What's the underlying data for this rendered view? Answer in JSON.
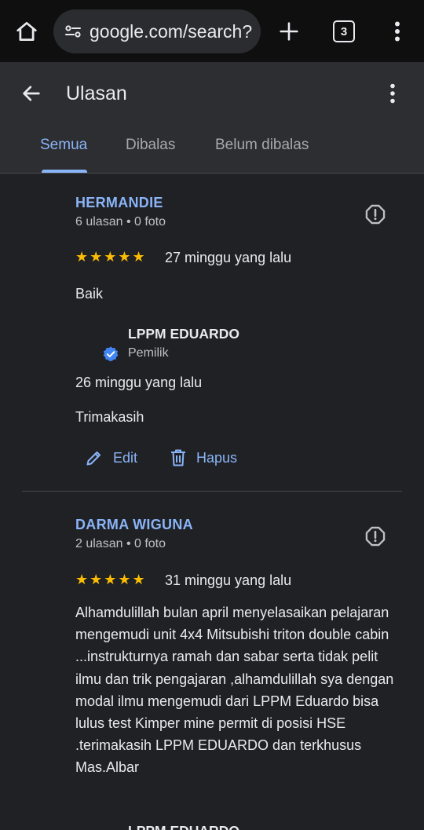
{
  "browser": {
    "url": "google.com/search?",
    "tab_count": "3"
  },
  "header": {
    "title": "Ulasan",
    "tabs": [
      {
        "label": "Semua"
      },
      {
        "label": "Dibalas"
      },
      {
        "label": "Belum dibalas"
      }
    ]
  },
  "reviews": [
    {
      "name": "HERMANDIE",
      "meta": "6 ulasan • 0 foto",
      "stars": "★★★★★",
      "rating": 5,
      "time": "27 minggu yang lalu",
      "text": "Baik",
      "reply": {
        "owner": "LPPM EDUARDO",
        "role": "Pemilik",
        "time": "26 minggu yang lalu",
        "text": "Trimakasih",
        "edit_label": "Edit",
        "delete_label": "Hapus"
      }
    },
    {
      "name": "DARMA WIGUNA",
      "meta": "2 ulasan • 0 foto",
      "stars": "★★★★★",
      "rating": 5,
      "time": "31 minggu yang lalu",
      "text": "Alhamdulillah bulan april menyelasaikan pelajaran mengemudi unit 4x4 Mitsubishi triton double cabin ...instrukturnya ramah dan sabar serta tidak pelit ilmu dan trik pengajaran ,alhamdulillah sya dengan modal ilmu mengemudi dari LPPM Eduardo bisa lulus test Kimper mine permit di posisi HSE .terimakasih LPPM EDUARDO dan terkhusus Mas.Albar",
      "reply": {
        "owner": "LPPM EDUARDO"
      }
    }
  ],
  "colors": {
    "accent": "#8ab4f8",
    "star": "#fbbc04",
    "verified_badge": "#4285f4"
  }
}
